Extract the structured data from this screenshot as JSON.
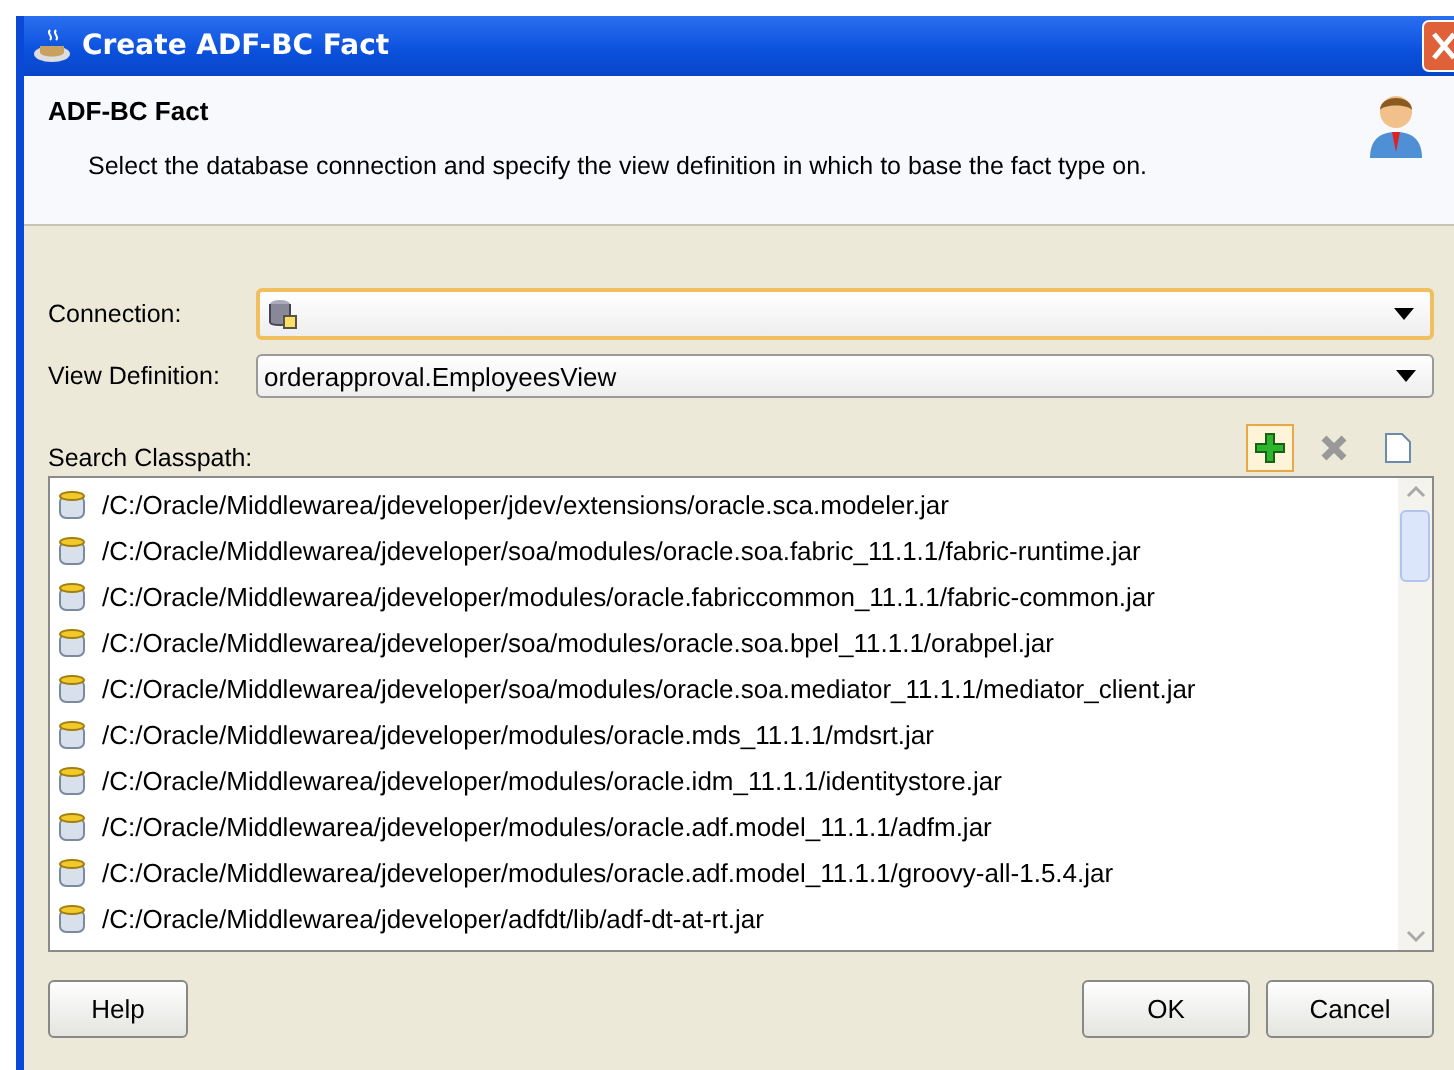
{
  "window": {
    "title": "Create ADF-BC Fact"
  },
  "header": {
    "title": "ADF-BC Fact",
    "description": "Select the database connection and specify the view definition in which to base the fact type on."
  },
  "form": [
    {
      "label": "Connection:"
    },
    {
      "label": "View Definition:",
      "value": "orderapproval.EmployeesView"
    }
  ],
  "classpath": {
    "label": "Search Classpath:",
    "items": [
      "/C:/Oracle/Middlewarea/jdeveloper/jdev/extensions/oracle.sca.modeler.jar",
      "/C:/Oracle/Middlewarea/jdeveloper/soa/modules/oracle.soa.fabric_11.1.1/fabric-runtime.jar",
      "/C:/Oracle/Middlewarea/jdeveloper/modules/oracle.fabriccommon_11.1.1/fabric-common.jar",
      "/C:/Oracle/Middlewarea/jdeveloper/soa/modules/oracle.soa.bpel_11.1.1/orabpel.jar",
      "/C:/Oracle/Middlewarea/jdeveloper/soa/modules/oracle.soa.mediator_11.1.1/mediator_client.jar",
      "/C:/Oracle/Middlewarea/jdeveloper/modules/oracle.mds_11.1.1/mdsrt.jar",
      "/C:/Oracle/Middlewarea/jdeveloper/modules/oracle.idm_11.1.1/identitystore.jar",
      "/C:/Oracle/Middlewarea/jdeveloper/modules/oracle.adf.model_11.1.1/adfm.jar",
      "/C:/Oracle/Middlewarea/jdeveloper/modules/oracle.adf.model_11.1.1/groovy-all-1.5.4.jar",
      "/C:/Oracle/Middlewarea/jdeveloper/adfdt/lib/adf-dt-at-rt.jar"
    ]
  },
  "buttons": {
    "help": "Help",
    "ok": "OK",
    "cancel": "Cancel"
  }
}
